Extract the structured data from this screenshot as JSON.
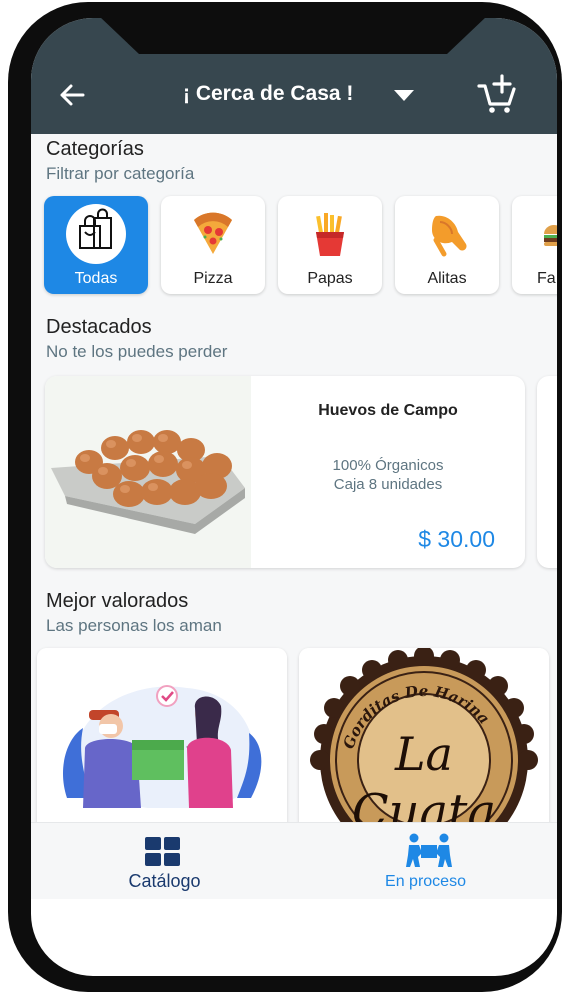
{
  "header": {
    "title": "¡ Cerca de Casa !",
    "back_icon": "arrow-left-icon",
    "dropdown_icon": "caret-down-icon",
    "cart_icon": "add-cart-icon"
  },
  "colors": {
    "appbar": "#37474f",
    "accent": "#1e88e5",
    "subtitle": "#5e7581",
    "background": "#f6f7f8"
  },
  "categories": {
    "title": "Categorías",
    "subtitle": "Filtrar por categoría",
    "items": [
      {
        "label": "Todas",
        "icon": "shopping-bags-icon",
        "active": true
      },
      {
        "label": "Pizza",
        "icon": "pizza-icon"
      },
      {
        "label": "Papas",
        "icon": "fries-icon"
      },
      {
        "label": "Alitas",
        "icon": "chicken-wing-icon"
      },
      {
        "label": "Fa",
        "icon": "burger-icon"
      }
    ]
  },
  "featured": {
    "title": "Destacados",
    "subtitle": "No te los puedes perder",
    "items": [
      {
        "name": "Huevos de Campo",
        "desc_line1": "100% Órganicos",
        "desc_line2": "Caja 8 unidades",
        "price": "$ 30.00"
      }
    ]
  },
  "top_rated": {
    "title": "Mejor valorados",
    "subtitle": "Las personas los aman",
    "logo": {
      "line1": "Gorditas De Harina",
      "line2": "La",
      "line3": "Cuata"
    }
  },
  "bottom_nav": {
    "items": [
      {
        "label": "Catálogo",
        "icon": "grid-icon"
      },
      {
        "label": "En proceso",
        "icon": "people-carrying-box-icon"
      }
    ]
  }
}
